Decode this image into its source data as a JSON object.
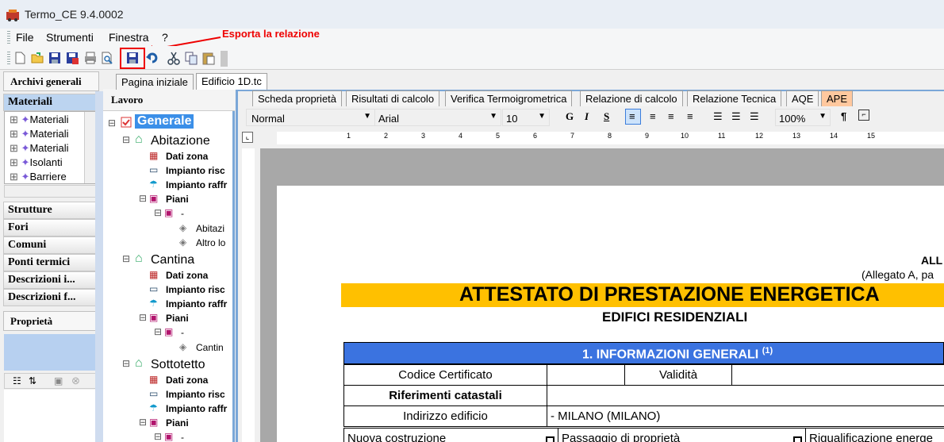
{
  "window": {
    "title": "Termo_CE 9.4.0002"
  },
  "menu": {
    "items": [
      "File",
      "Strumenti",
      "Finestra",
      "?"
    ]
  },
  "annotation": {
    "text": "Esporta la relazione"
  },
  "toolbar": {
    "icons": [
      "new-icon",
      "open-icon",
      "save-icon",
      "save-as-icon",
      "print-icon",
      "print-preview-icon",
      "export-relazione-icon",
      "undo-icon",
      "cut-icon",
      "copy-icon",
      "paste-icon"
    ]
  },
  "left": {
    "archivi_title": "Archivi generali",
    "materiali_header": "Materiali",
    "materiali_items": [
      "Materiali",
      "Materiali",
      "Materiali",
      "Isolanti",
      "Barriere"
    ],
    "sections": [
      "Strutture",
      "Fori",
      "Comuni",
      "Ponti termici",
      "Descrizioni  i...",
      "Descrizioni  f..."
    ],
    "proprieta_title": "Proprietà"
  },
  "tree": {
    "title": "Lavoro",
    "root": "Generale",
    "groups": [
      {
        "name": "Abitazione",
        "dati": "Dati zona",
        "risc": "Impianto risc",
        "raffr": "Impianto raffr",
        "piani": "Piani",
        "dash": "-",
        "leaves": [
          "Abitazi",
          "Altro lo"
        ]
      },
      {
        "name": "Cantina",
        "dati": "Dati zona",
        "risc": "Impianto risc",
        "raffr": "Impianto raffr",
        "piani": "Piani",
        "dash": "-",
        "leaves": [
          "Cantin"
        ]
      },
      {
        "name": "Sottotetto",
        "dati": "Dati zona",
        "risc": "Impianto risc",
        "raffr": "Impianto raffr",
        "piani": "Piani",
        "dash": "-",
        "leaves": []
      }
    ]
  },
  "doctabs": [
    "Pagina iniziale",
    "Edificio 1D.tc"
  ],
  "subtabs": [
    "Scheda proprietà",
    "Risultati di calcolo",
    "Verifica Termoigrometrica",
    "Relazione di calcolo",
    "Relazione Tecnica",
    "AQE",
    "APE"
  ],
  "format": {
    "style": "Normal",
    "font": "Arial",
    "size": "10",
    "zoom": "100%",
    "bold": "G",
    "italic": "I",
    "underline": "S"
  },
  "ruler": {
    "numbers": [
      "1",
      "2",
      "3",
      "4",
      "5",
      "6",
      "7",
      "8",
      "9",
      "10",
      "11",
      "12",
      "13",
      "14",
      "15"
    ]
  },
  "document": {
    "all": "ALL",
    "allegato": "(Allegato A, pa",
    "title": "ATTESTATO DI PRESTAZIONE ENERGETICA",
    "subtitle": "EDIFICI RESIDENZIALI",
    "section": "1. INFORMAZIONI GENERALI",
    "section_sup": "(1)",
    "codice": "Codice Certificato",
    "validita": "Validità",
    "catastali": "Riferimenti catastali",
    "indirizzo_label": "Indirizzo edificio",
    "indirizzo_value": "- MILANO (MILANO)",
    "nuova": "Nuova costruzione",
    "passaggio": "Passaggio di proprietà",
    "riqualificazione": "Riqualificazione energe"
  }
}
